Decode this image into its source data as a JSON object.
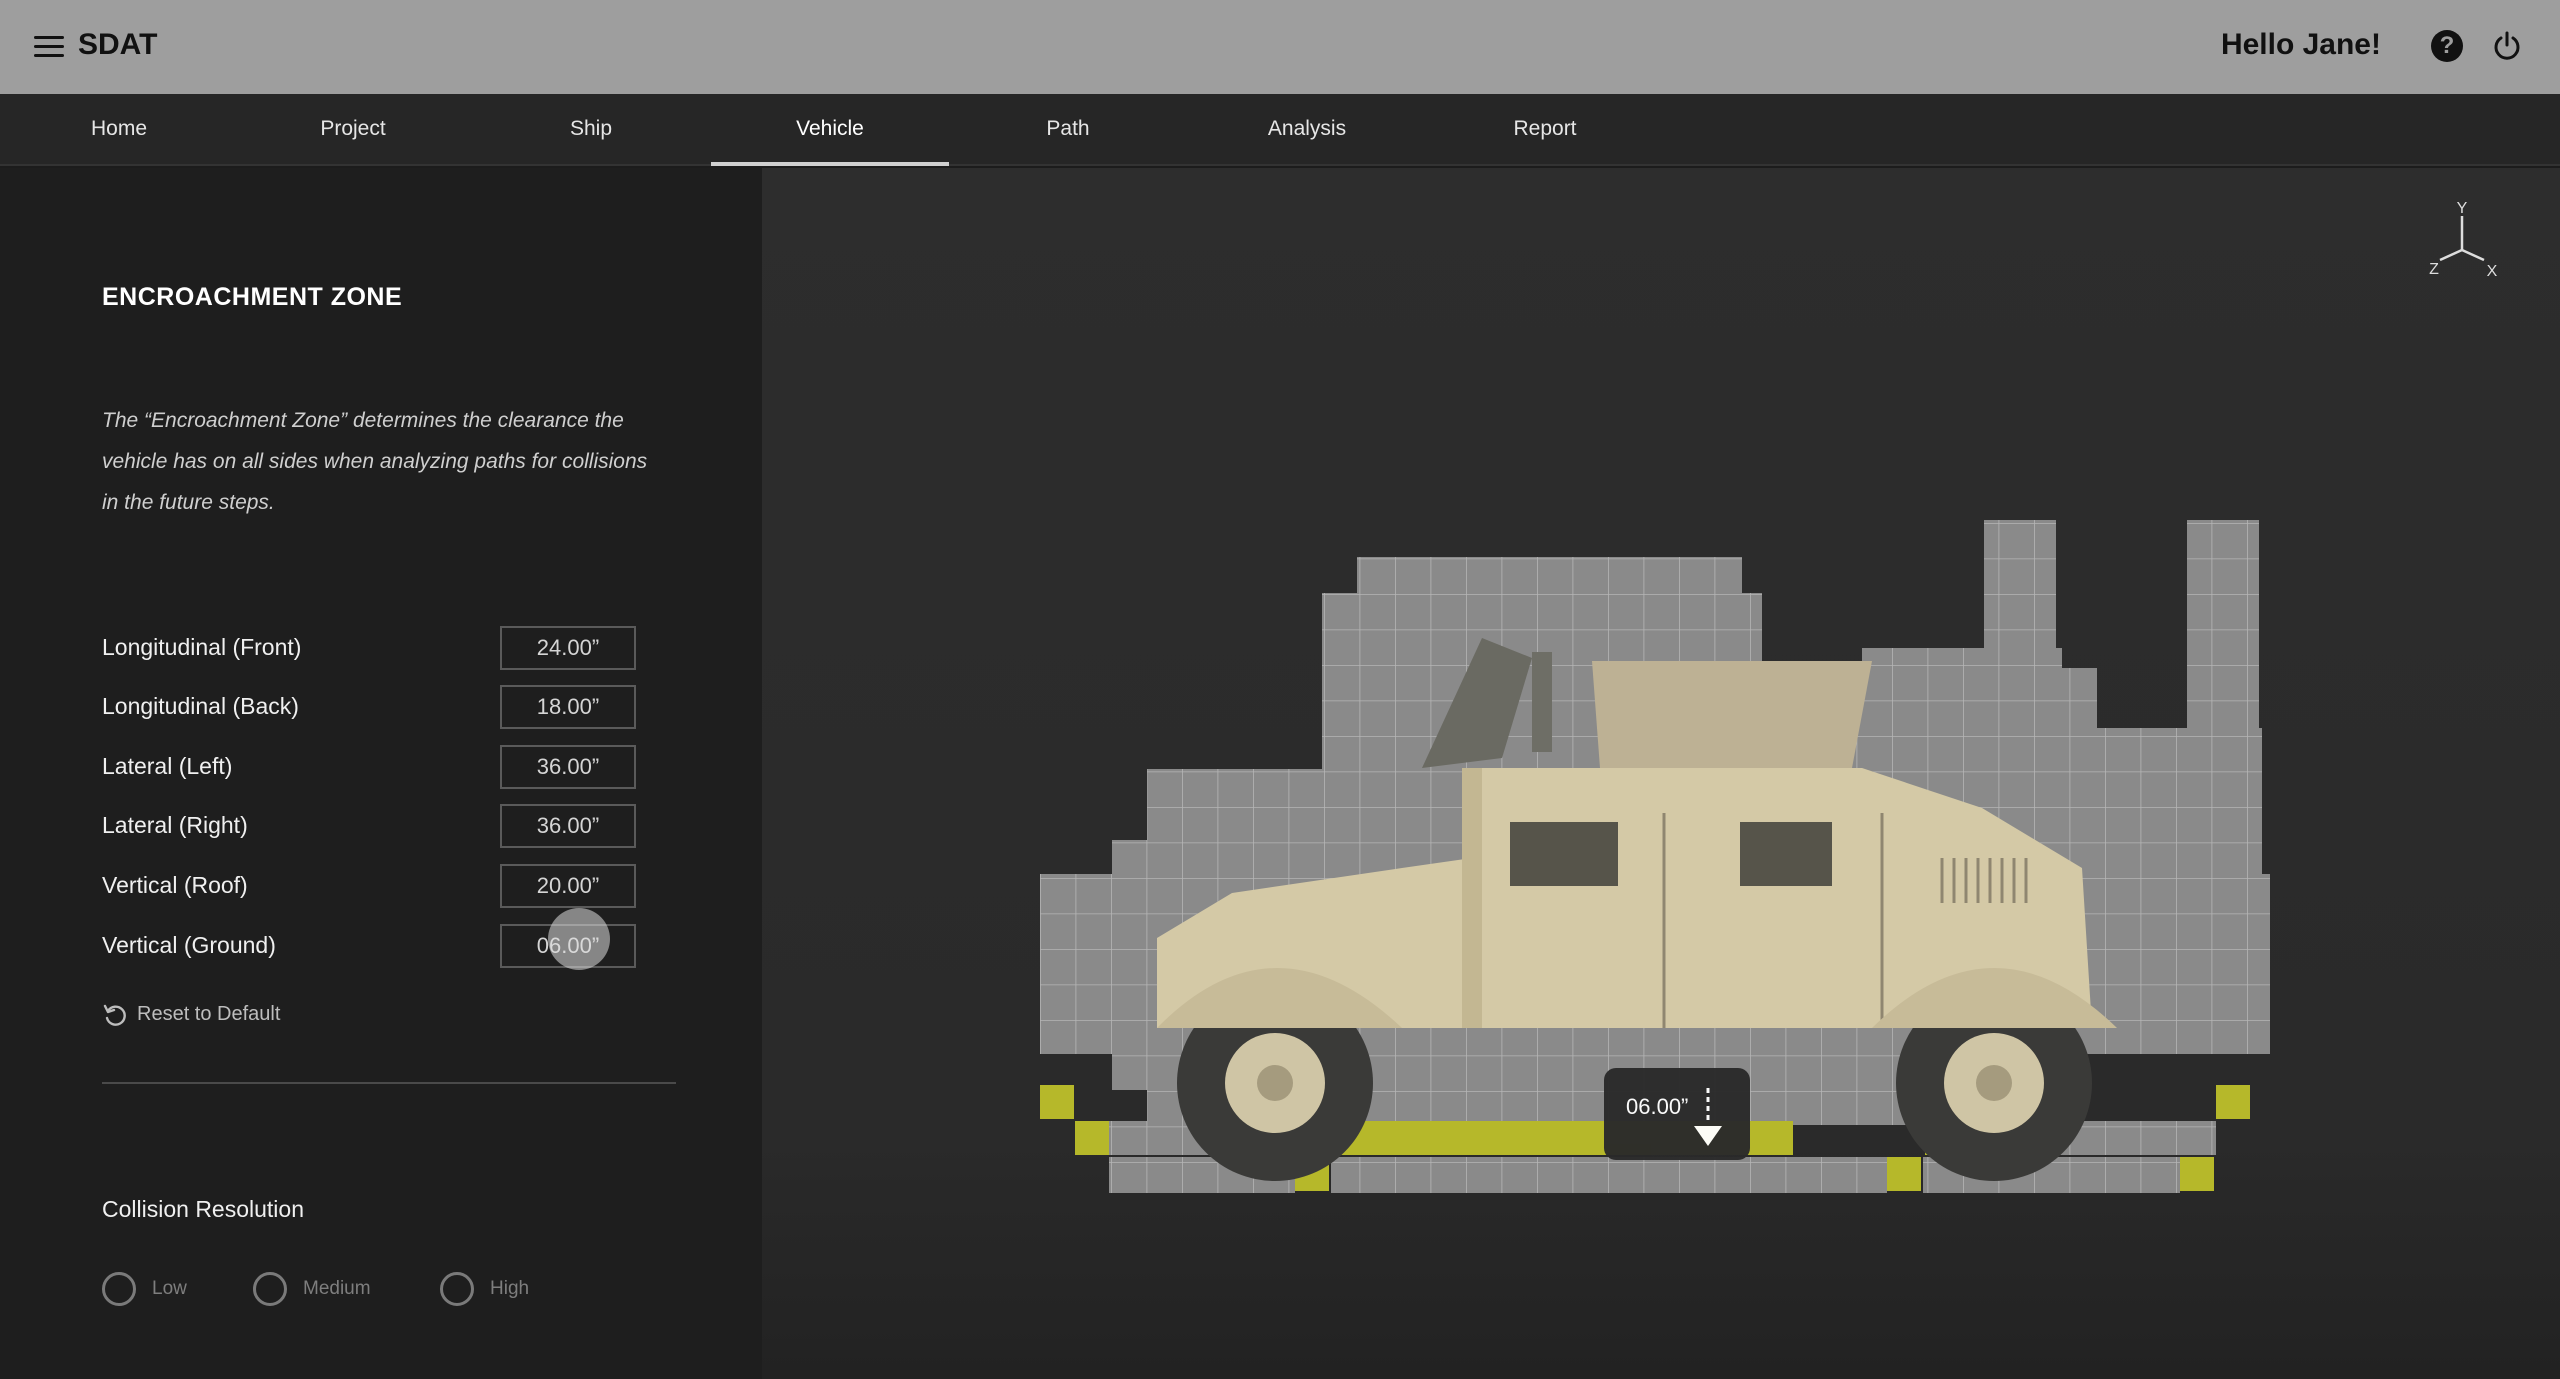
{
  "app": {
    "title": "SDAT",
    "greeting": "Hello Jane!"
  },
  "icons": {
    "menu": "hamburger-menu-icon",
    "help": "question-circle-icon",
    "power": "power-icon",
    "reset": "undo-icon",
    "axes": "xyz-axes-icon"
  },
  "tabs": [
    {
      "label": "Home"
    },
    {
      "label": "Project"
    },
    {
      "label": "Ship"
    },
    {
      "label": "Vehicle",
      "active": true
    },
    {
      "label": "Path"
    },
    {
      "label": "Analysis"
    },
    {
      "label": "Report"
    }
  ],
  "panel": {
    "title": "ENCROACHMENT ZONE",
    "description": "The “Encroachment Zone” determines the clearance the vehicle has on all sides when analyzing paths for collisions in the future steps.",
    "fields": [
      {
        "label": "Longitudinal (Front)",
        "value": "24.00”"
      },
      {
        "label": "Longitudinal (Back)",
        "value": "18.00”"
      },
      {
        "label": "Lateral (Left)",
        "value": "36.00”"
      },
      {
        "label": "Lateral (Right)",
        "value": "36.00”"
      },
      {
        "label": "Vertical (Roof)",
        "value": "20.00”"
      },
      {
        "label": "Vertical (Ground)",
        "value": "06.00”"
      }
    ],
    "reset_label": "Reset to Default",
    "collision_title": "Collision Resolution",
    "resolution_options": [
      "Low",
      "Medium",
      "High"
    ]
  },
  "viewport": {
    "axis_labels": {
      "y": "Y",
      "z": "Z",
      "x": "X"
    },
    "tooltip_value": "06.00”",
    "colors": {
      "grid": "#8c8c8c",
      "ground_highlight": "#b6b82a",
      "vehicle": "#d4c9a6"
    }
  }
}
